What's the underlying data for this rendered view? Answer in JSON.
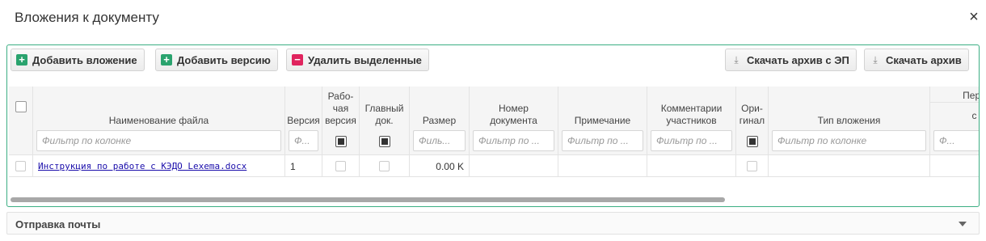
{
  "dialog": {
    "title": "Вложения к документу",
    "close_glyph": "×"
  },
  "toolbar": {
    "add_attachment": "Добавить вложение",
    "add_version": "Добавить версию",
    "delete_selected": "Удалить выделенные",
    "download_archive_ep": "Скачать архив с ЭП",
    "download_archive": "Скачать архив"
  },
  "table": {
    "columns": {
      "file_name": "Наименование файла",
      "version": "Версия",
      "working_version": "Рабо-\nчая\nверсия",
      "main_doc": "Главный\nдок.",
      "size": "Размер",
      "doc_number": "Номер\nдокумента",
      "note": "Примечание",
      "comments": "Комментарии\nучастников",
      "original": "Ори-\nгинал",
      "attachment_type": "Тип вложения",
      "period": "Пери",
      "period_from": "с"
    },
    "filter_placeholder": "Фильтр по колонке",
    "filter_short": "Ф...",
    "filter_medium": "Филь...",
    "filter_long": "Фильтр по ...",
    "rows": [
      {
        "file_name": "Инструкция по работе с КЭДО Lexema.docx",
        "version": "1",
        "size": "0.00 K"
      }
    ]
  },
  "mail_section": {
    "label": "Отправка почты"
  }
}
